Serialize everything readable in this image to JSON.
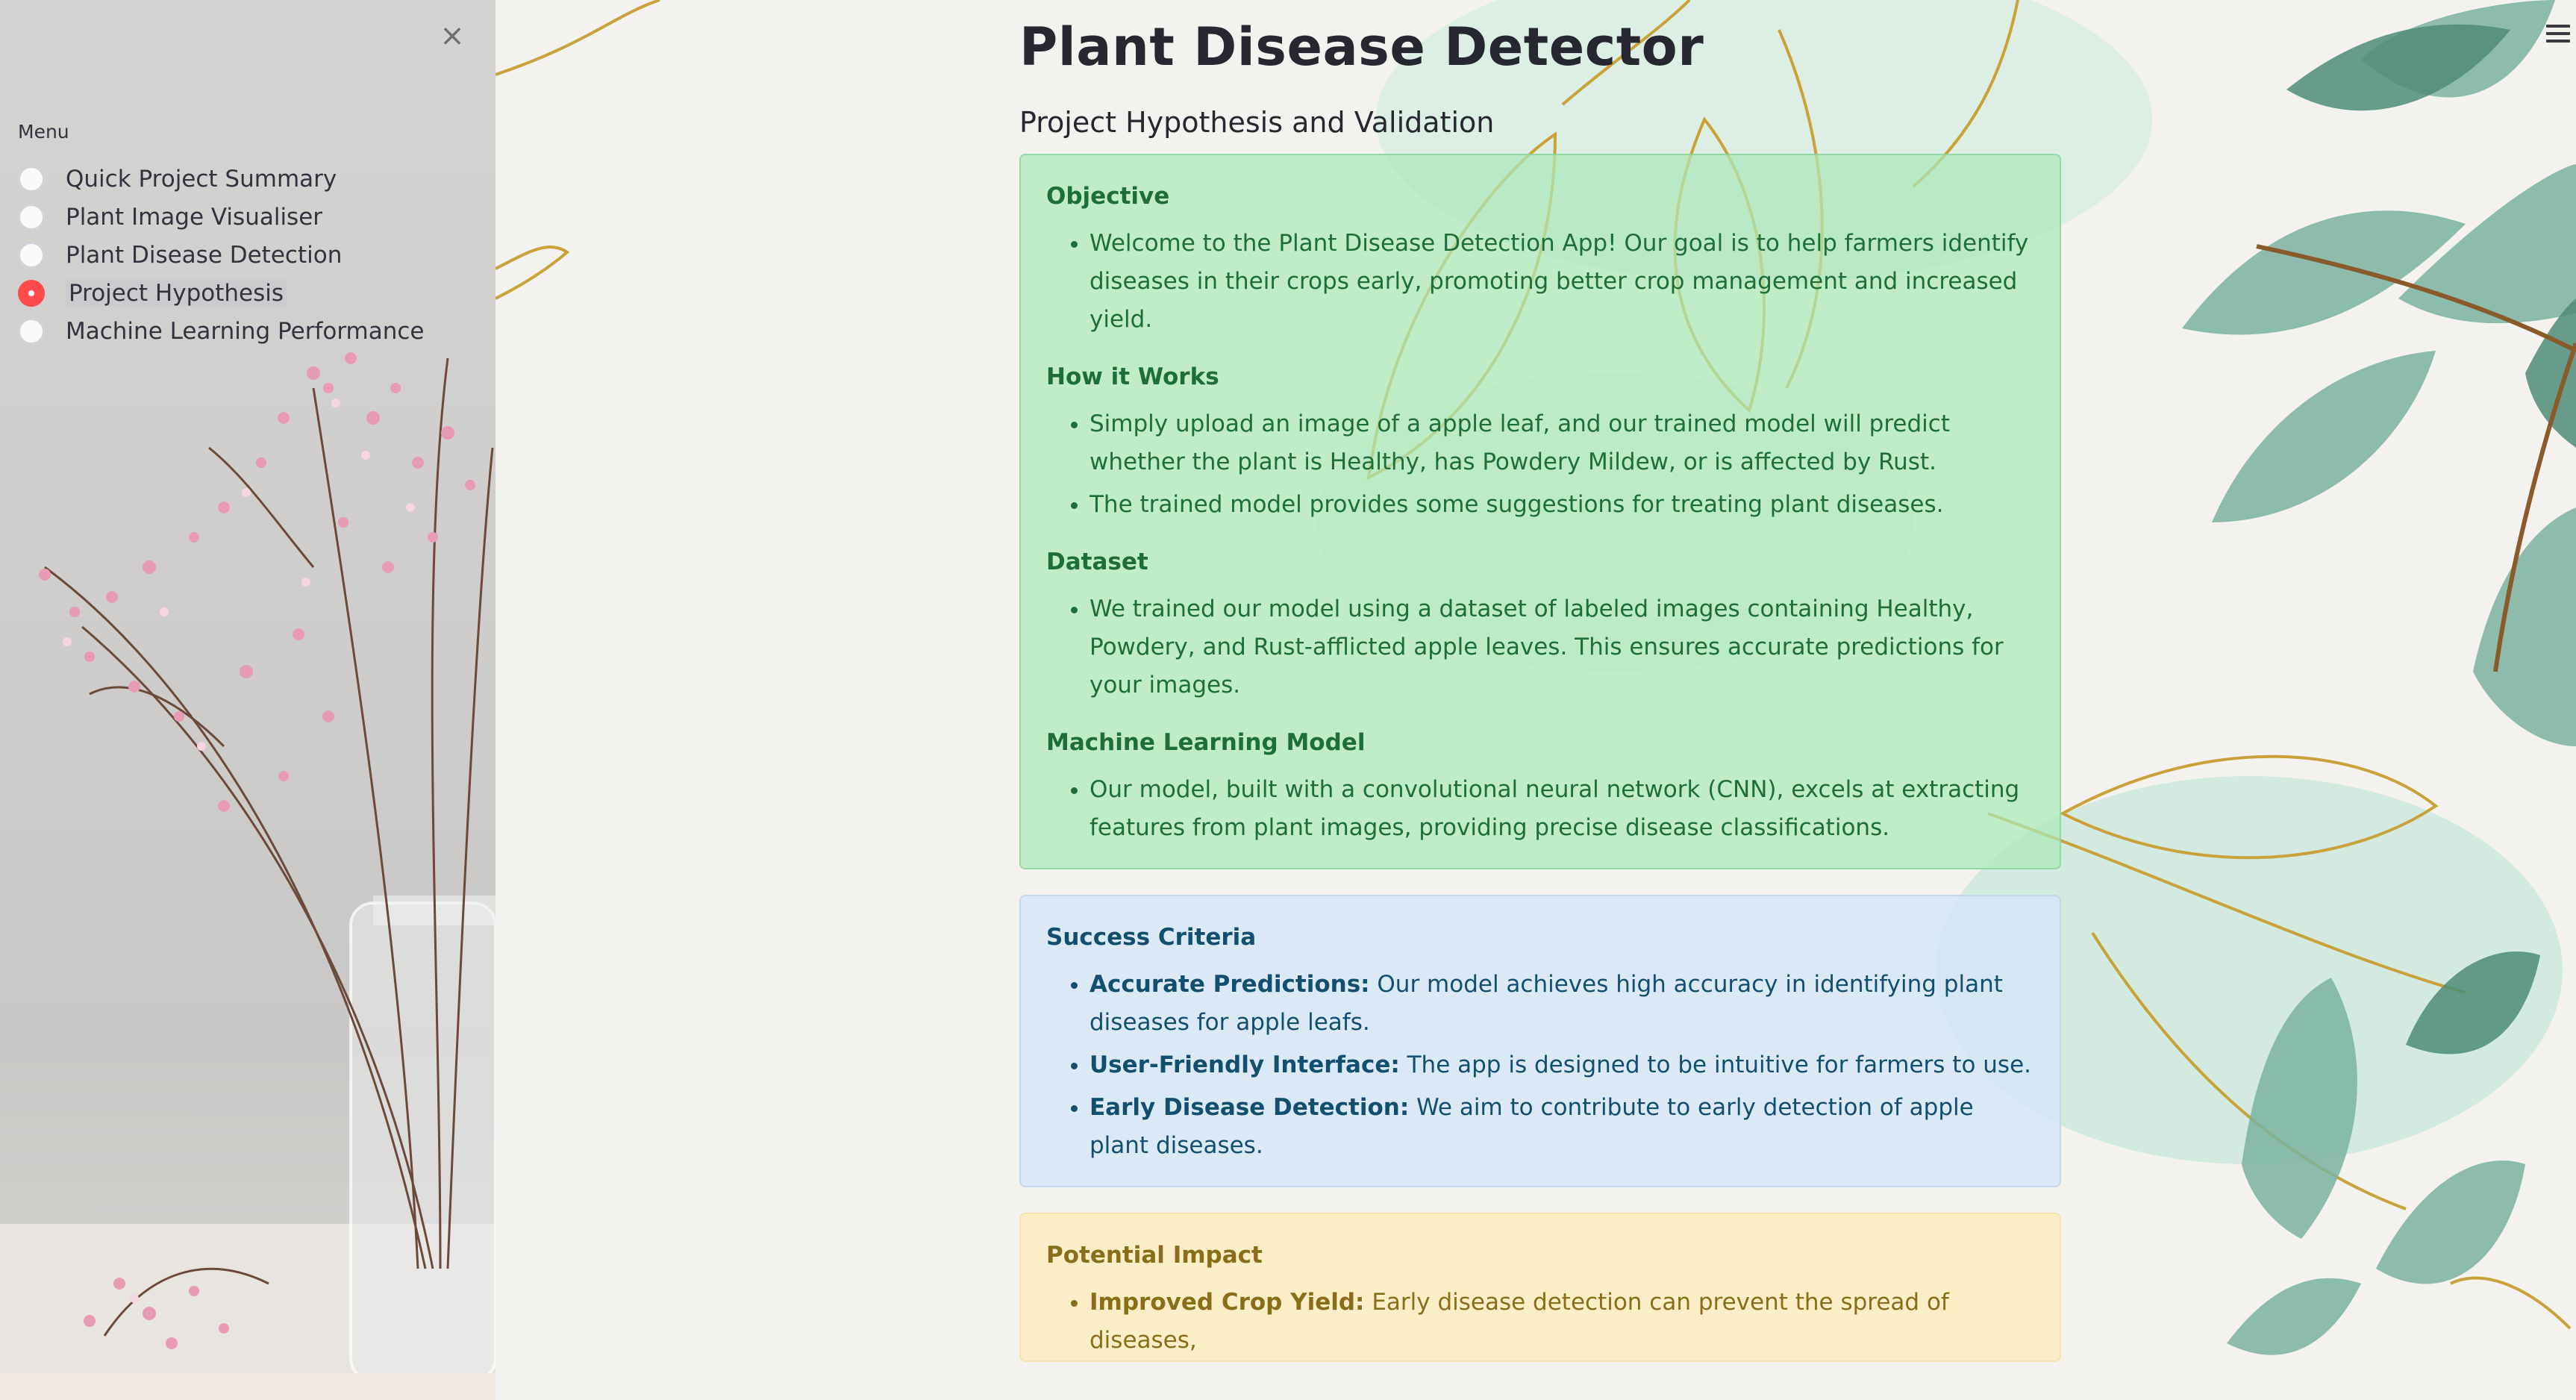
{
  "sidebar": {
    "close_icon": "×",
    "menu_label": "Menu",
    "items": [
      {
        "label": "Quick Project Summary",
        "selected": false
      },
      {
        "label": "Plant Image Visualiser",
        "selected": false
      },
      {
        "label": "Plant Disease Detection",
        "selected": false
      },
      {
        "label": "Project Hypothesis",
        "selected": true
      },
      {
        "label": "Machine Learning Performance",
        "selected": false
      }
    ],
    "accent_color": "#ff4b4b"
  },
  "main": {
    "title": "Plant Disease Detector",
    "subheader": "Project Hypothesis and Validation",
    "sections": {
      "objective": {
        "heading": "Objective",
        "items": [
          "Welcome to the Plant Disease Detection App! Our goal is to help farmers identify diseases in their crops early, promoting better crop management and increased yield."
        ]
      },
      "how_it_works": {
        "heading": "How it Works",
        "items": [
          "Simply upload an image of a apple leaf, and our trained model will predict whether the plant is Healthy, has Powdery Mildew, or is affected by Rust.",
          "The trained model provides some suggestions for treating plant diseases."
        ]
      },
      "dataset": {
        "heading": "Dataset",
        "items": [
          "We trained our model using a dataset of labeled images containing Healthy, Powdery, and Rust-afflicted apple leaves. This ensures accurate predictions for your images."
        ]
      },
      "ml_model": {
        "heading": "Machine Learning Model",
        "items": [
          "Our model, built with a convolutional neural network (CNN), excels at extracting features from plant images, providing precise disease classifications."
        ]
      },
      "success": {
        "heading": "Success Criteria",
        "items": [
          {
            "bold": "Accurate Predictions:",
            "text": " Our model achieves high accuracy in identifying plant diseases for apple leafs."
          },
          {
            "bold": "User-Friendly Interface:",
            "text": " The app is designed to be intuitive for farmers to use."
          },
          {
            "bold": "Early Disease Detection:",
            "text": " We aim to contribute to early detection of apple plant diseases."
          }
        ]
      },
      "impact": {
        "heading": "Potential Impact",
        "items": [
          {
            "bold": "Improved Crop Yield:",
            "text": " Early disease detection can prevent the spread of diseases,"
          }
        ]
      }
    },
    "colors": {
      "success_bg": "#ace9b8",
      "info_bg": "#d6e7f8",
      "warning_bg": "#fbedbe"
    }
  }
}
